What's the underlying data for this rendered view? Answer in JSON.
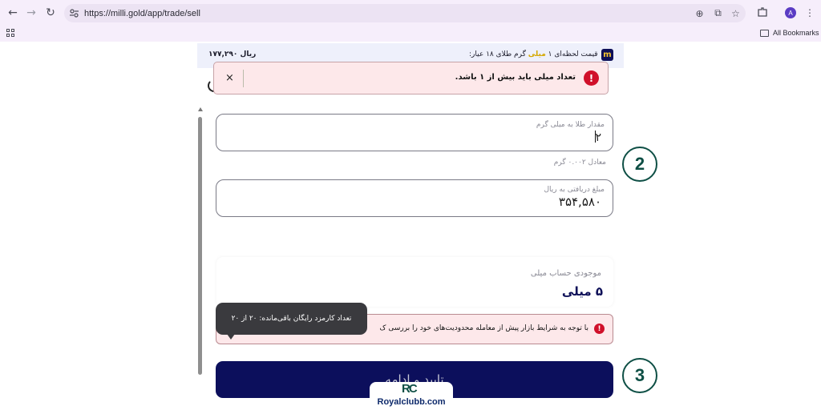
{
  "browser": {
    "url": "https://milli.gold/app/trade/sell",
    "bookmarks_label": "All Bookmarks",
    "profile_initial": "A"
  },
  "price_bar": {
    "prefix": "قیمت لحظه‌ای ۱",
    "highlight": "میلی",
    "suffix": "گرم طلای ۱۸ عیار:",
    "price": "۱۷۷,۲۹۰ ریال",
    "logo": "m"
  },
  "toast": {
    "message": "تعداد میلی باید بیش از ۱ باشد.",
    "close": "×",
    "icon": "!"
  },
  "form": {
    "amount_label": "مقدار طلا به میلی گرم",
    "amount_value": "۲",
    "equivalent": "معادل ۰.۰۰۲ گرم",
    "rial_label": "مبلغ دریافتی به ریال",
    "rial_value": "۳۵۴,۵۸۰"
  },
  "annotations": {
    "step_2": "2",
    "step_3": "3"
  },
  "balance": {
    "label": "موجودی حساب میلی",
    "value": "۵ میلی"
  },
  "warning": {
    "message": "با توجه به شرایط بازار پیش از معامله محدودیت‌های خود را بررسی ک",
    "icon": "!"
  },
  "tooltip": {
    "text": "تعداد کارمزد رایگان باقی‌مانده: ۲۰ از ۲۰"
  },
  "submit_label": "تایید و ادامه",
  "watermark": {
    "logo": "RC",
    "text": "Royalclubb.com"
  },
  "colors": {
    "brand_navy": "#0c0f5c",
    "error_red": "#d0102a",
    "gold": "#d4a700",
    "annotation_green": "#0e4f45"
  }
}
